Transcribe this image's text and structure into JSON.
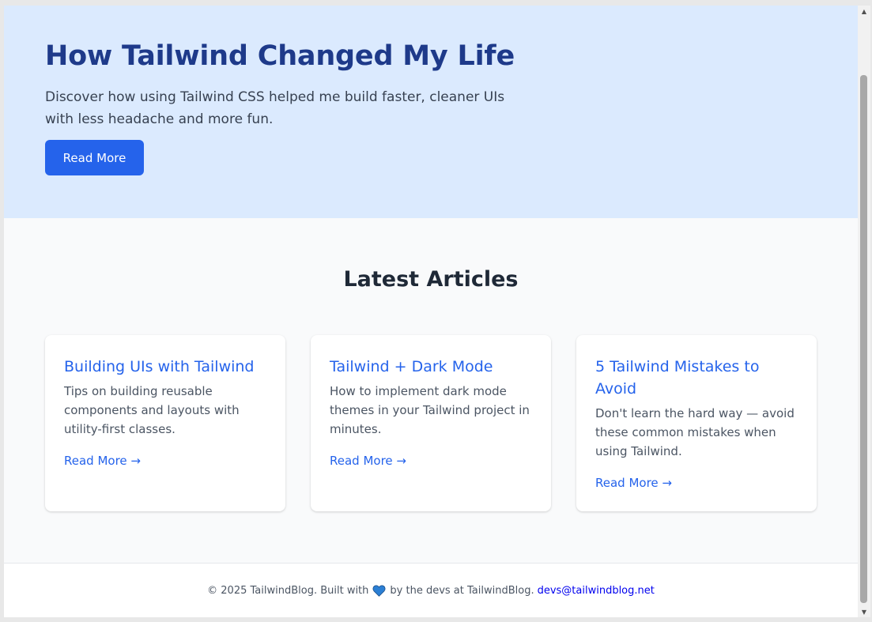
{
  "hero": {
    "title": "How Tailwind Changed My Life",
    "description": "Discover how using Tailwind CSS helped me build faster, cleaner UIs with less headache and more fun.",
    "button_label": "Read More"
  },
  "articles": {
    "heading": "Latest Articles",
    "items": [
      {
        "title": "Building UIs with Tailwind",
        "description": "Tips on building reusable components and layouts with utility-first classes.",
        "link": "Read More →"
      },
      {
        "title": "Tailwind + Dark Mode",
        "description": "How to implement dark mode themes in your Tailwind project in minutes.",
        "link": "Read More →"
      },
      {
        "title": "5 Tailwind Mistakes to Avoid",
        "description": "Don't learn the hard way — avoid these common mistakes when using Tailwind.",
        "link": "Read More →"
      }
    ]
  },
  "footer": {
    "text_before": "© 2025 TailwindBlog. Built with",
    "icon": "blue-heart-icon",
    "text_after": "by the devs at TailwindBlog.",
    "email": "devs@tailwindblog.net"
  },
  "colors": {
    "hero_bg": "#dbeafe",
    "hero_title": "#1e3a8a",
    "accent": "#2563eb",
    "page_bg": "#f9fafb",
    "heart": "#2b7fd4"
  },
  "scrollbar": {
    "up_icon": "scroll-up-arrow-icon",
    "down_icon": "scroll-down-arrow-icon"
  }
}
